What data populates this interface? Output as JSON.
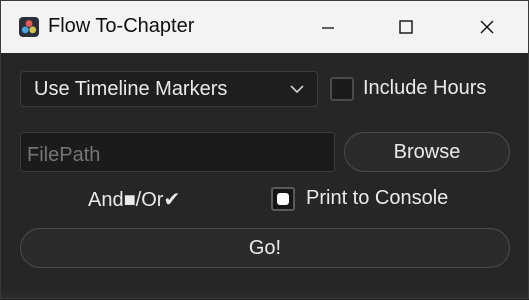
{
  "window": {
    "title": "Flow To-Chapter",
    "controls": {
      "minimize": "minimize-icon",
      "maximize": "maximize-icon",
      "close": "close-icon"
    }
  },
  "options": {
    "marker_mode": "Use Timeline Markers",
    "include_hours_label": "Include Hours",
    "include_hours_checked": false
  },
  "file": {
    "placeholder": "FilePath",
    "value": "",
    "browse_label": "Browse"
  },
  "logic": {
    "and_or_label": "And■/Or✔",
    "print_label": "Print to Console",
    "print_checked": true
  },
  "actions": {
    "go_label": "Go!"
  },
  "colors": {
    "background": "#262626",
    "titlebar": "#f3f3f3",
    "text": "#eaeaea"
  }
}
